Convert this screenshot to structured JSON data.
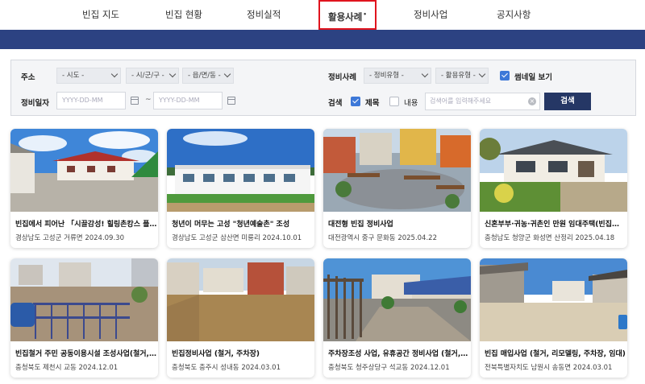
{
  "nav": {
    "items": [
      "빈집 지도",
      "빈집 현황",
      "정비실적",
      "활용사례",
      "정비사업",
      "공지사항"
    ],
    "active_index": 3
  },
  "filter": {
    "address_label": "주소",
    "sido": "- 시도 -",
    "sigungu": "- 시/군/구 -",
    "eupmyeon": "- 읍/면/동 -",
    "case_label": "정비사례",
    "repair_type": "- 정비유형 -",
    "use_type": "- 활용유형 -",
    "thumbnail_label": "썸네일 보기",
    "date_label": "정비일자",
    "date_from_placeholder": "YYYY-DD-MM",
    "date_to_placeholder": "YYYY-DD-MM",
    "tilde": "~",
    "search_label": "검색",
    "title_option": "제목",
    "content_option": "내용",
    "search_placeholder": "검색어를 입력해주세요",
    "search_button": "검색"
  },
  "cards": [
    {
      "title": "빈집에서 피어난 「시끌감성! 힐링촌캉스 플…",
      "location": "경상남도 고성군 거류면",
      "date": "2024.09.30",
      "image": "white-red-roof-house-blue-sky"
    },
    {
      "title": "청년이 머무는 고성 \"청년예술촌\" 조성",
      "location": "경상남도 고성군 삼산면 미룡리",
      "date": "2024.10.01",
      "image": "white-long-building-lawn"
    },
    {
      "title": "대전형 빈집 정비사업",
      "location": "대전광역시 중구 문화동",
      "date": "2025.04.22",
      "image": "small-park-benches"
    },
    {
      "title": "신혼부부·귀농·귀촌인 만원 임대주택(빈집…",
      "location": "충청남도 청양군 화성면 산정리",
      "date": "2025.04.18",
      "image": "renovated-hanok-house"
    },
    {
      "title": "빈집철거 주민 공동이용시설 조성사업(철거,…",
      "location": "충청북도 제천시 교동",
      "date": "2024.12.01",
      "image": "fenced-empty-lot-blue-car"
    },
    {
      "title": "빈집정비사업 (철거, 주차장)",
      "location": "충청북도 충주시 성내동",
      "date": "2024.03.01",
      "image": "dirt-lot-between-houses"
    },
    {
      "title": "주차장조성 사업, 유휴공간 정비사업 (철거,…",
      "location": "충청북도 청주상당구 석교동",
      "date": "2024.12.01",
      "image": "stone-path-fence"
    },
    {
      "title": "빈집 매입사업 (철거, 리모델링, 주차장, 임대)",
      "location": "전북특별자치도 남원시 송동면",
      "date": "2024.03.01",
      "image": "gravel-lot-houses"
    }
  ],
  "colors": {
    "navbar": "#2c4282",
    "active_border": "#e0141e",
    "search_button": "#253765",
    "checkbox": "#3d78d8"
  }
}
